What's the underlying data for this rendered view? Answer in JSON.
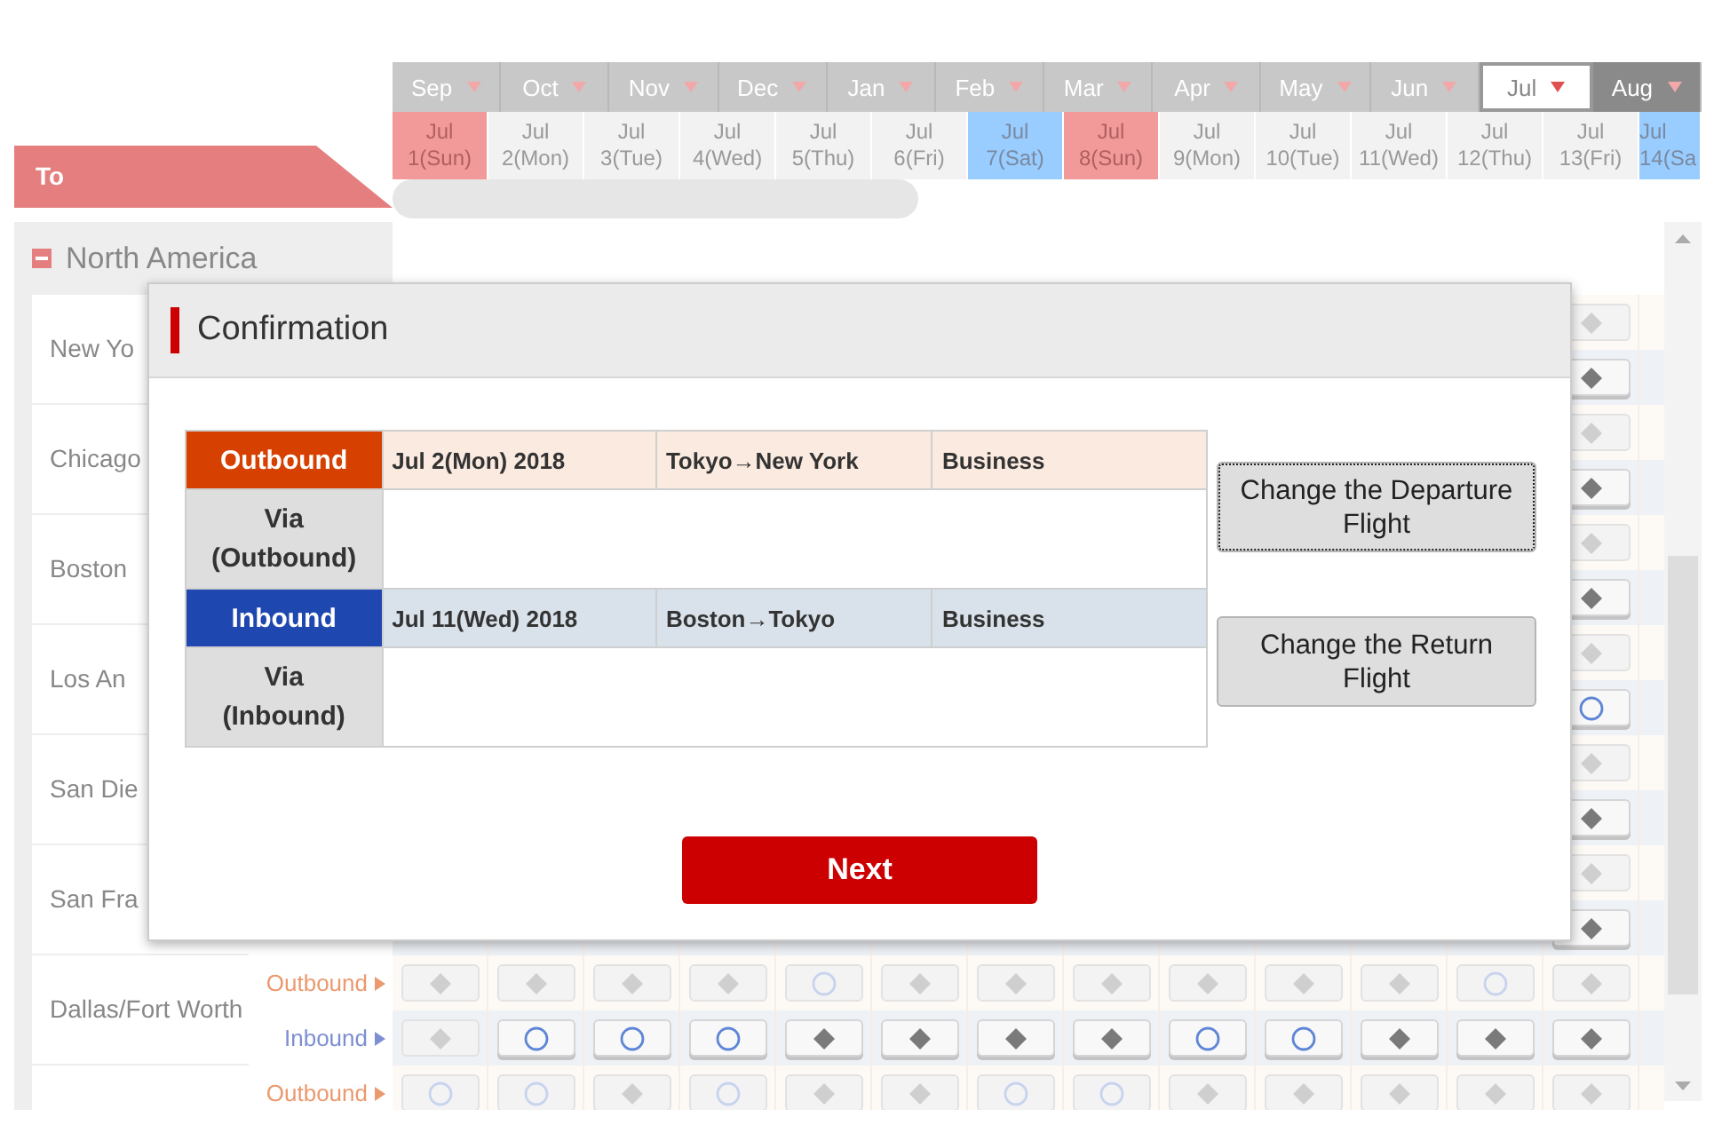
{
  "to_label": "To",
  "months": [
    {
      "label": "Sep",
      "selected": false,
      "highlighted": false
    },
    {
      "label": "Oct",
      "selected": false,
      "highlighted": false
    },
    {
      "label": "Nov",
      "selected": false,
      "highlighted": false
    },
    {
      "label": "Dec",
      "selected": false,
      "highlighted": false
    },
    {
      "label": "Jan",
      "selected": false,
      "highlighted": false
    },
    {
      "label": "Feb",
      "selected": false,
      "highlighted": false
    },
    {
      "label": "Mar",
      "selected": false,
      "highlighted": false
    },
    {
      "label": "Apr",
      "selected": false,
      "highlighted": false
    },
    {
      "label": "May",
      "selected": false,
      "highlighted": false
    },
    {
      "label": "Jun",
      "selected": false,
      "highlighted": false
    },
    {
      "label": "Jul",
      "selected": true,
      "highlighted": false
    },
    {
      "label": "Aug",
      "selected": false,
      "highlighted": true
    }
  ],
  "days": [
    {
      "month": "Jul",
      "day": "1(Sun)",
      "kind": "sunday"
    },
    {
      "month": "Jul",
      "day": "2(Mon)",
      "kind": "weekday"
    },
    {
      "month": "Jul",
      "day": "3(Tue)",
      "kind": "weekday"
    },
    {
      "month": "Jul",
      "day": "4(Wed)",
      "kind": "weekday"
    },
    {
      "month": "Jul",
      "day": "5(Thu)",
      "kind": "weekday"
    },
    {
      "month": "Jul",
      "day": "6(Fri)",
      "kind": "weekday"
    },
    {
      "month": "Jul",
      "day": "7(Sat)",
      "kind": "saturday"
    },
    {
      "month": "Jul",
      "day": "8(Sun)",
      "kind": "sunday"
    },
    {
      "month": "Jul",
      "day": "9(Mon)",
      "kind": "weekday"
    },
    {
      "month": "Jul",
      "day": "10(Tue)",
      "kind": "weekday"
    },
    {
      "month": "Jul",
      "day": "11(Wed)",
      "kind": "weekday"
    },
    {
      "month": "Jul",
      "day": "12(Thu)",
      "kind": "weekday"
    },
    {
      "month": "Jul",
      "day": "13(Fri)",
      "kind": "weekday"
    },
    {
      "month": "Jul",
      "day": "14(Sa",
      "kind": "saturday"
    }
  ],
  "region": {
    "name": "North America",
    "expanded": true
  },
  "cities": [
    {
      "name": "New Yo",
      "rows": [
        {
          "kind": "outbound",
          "cells": [
            null,
            null,
            null,
            null,
            null,
            null,
            null,
            null,
            null,
            null,
            null,
            null,
            {
              "kind": "diamond",
              "enabled": false
            }
          ]
        },
        {
          "kind": "inbound",
          "cells": [
            null,
            null,
            null,
            null,
            null,
            null,
            null,
            null,
            null,
            null,
            null,
            null,
            {
              "kind": "diamond",
              "enabled": true
            }
          ]
        }
      ]
    },
    {
      "name": "Chicago",
      "rows": [
        {
          "kind": "outbound",
          "cells": [
            null,
            null,
            null,
            null,
            null,
            null,
            null,
            null,
            null,
            null,
            null,
            null,
            {
              "kind": "diamond",
              "enabled": false
            }
          ]
        },
        {
          "kind": "inbound",
          "cells": [
            null,
            null,
            null,
            null,
            null,
            null,
            null,
            null,
            null,
            null,
            null,
            null,
            {
              "kind": "diamond",
              "enabled": true
            }
          ]
        }
      ]
    },
    {
      "name": "Boston",
      "rows": [
        {
          "kind": "outbound",
          "cells": [
            null,
            null,
            null,
            null,
            null,
            null,
            null,
            null,
            null,
            null,
            null,
            null,
            {
              "kind": "diamond",
              "enabled": false
            }
          ]
        },
        {
          "kind": "inbound",
          "cells": [
            null,
            null,
            null,
            null,
            null,
            null,
            null,
            null,
            null,
            null,
            null,
            null,
            {
              "kind": "diamond",
              "enabled": true
            }
          ]
        }
      ]
    },
    {
      "name": "Los An",
      "rows": [
        {
          "kind": "outbound",
          "cells": [
            null,
            null,
            null,
            null,
            null,
            null,
            null,
            null,
            null,
            null,
            null,
            null,
            {
              "kind": "diamond",
              "enabled": false
            }
          ]
        },
        {
          "kind": "inbound",
          "cells": [
            null,
            null,
            null,
            null,
            null,
            null,
            null,
            null,
            null,
            null,
            null,
            null,
            {
              "kind": "circle",
              "enabled": true
            }
          ]
        }
      ]
    },
    {
      "name": "San Die",
      "rows": [
        {
          "kind": "outbound",
          "cells": [
            null,
            null,
            null,
            null,
            null,
            null,
            null,
            null,
            null,
            null,
            null,
            null,
            {
              "kind": "diamond",
              "enabled": false
            }
          ]
        },
        {
          "kind": "inbound",
          "cells": [
            null,
            null,
            null,
            null,
            null,
            null,
            null,
            null,
            null,
            null,
            null,
            null,
            {
              "kind": "diamond",
              "enabled": true
            }
          ]
        }
      ]
    },
    {
      "name": "San Fra",
      "rows": [
        {
          "kind": "outbound",
          "cells": [
            null,
            null,
            null,
            null,
            null,
            null,
            null,
            null,
            null,
            null,
            null,
            null,
            {
              "kind": "diamond",
              "enabled": false
            }
          ]
        },
        {
          "kind": "inbound",
          "cells": [
            null,
            null,
            null,
            null,
            null,
            null,
            null,
            null,
            null,
            null,
            null,
            null,
            {
              "kind": "diamond",
              "enabled": true
            }
          ]
        }
      ]
    },
    {
      "name": "Dallas/Fort Worth",
      "rows": [
        {
          "kind": "outbound",
          "label": "Outbound",
          "cells": [
            {
              "kind": "diamond",
              "enabled": false
            },
            {
              "kind": "diamond",
              "enabled": false
            },
            {
              "kind": "diamond",
              "enabled": false
            },
            {
              "kind": "diamond",
              "enabled": false
            },
            {
              "kind": "circle",
              "enabled": false
            },
            {
              "kind": "diamond",
              "enabled": false
            },
            {
              "kind": "diamond",
              "enabled": false
            },
            {
              "kind": "diamond",
              "enabled": false
            },
            {
              "kind": "diamond",
              "enabled": false
            },
            {
              "kind": "diamond",
              "enabled": false
            },
            {
              "kind": "diamond",
              "enabled": false
            },
            {
              "kind": "circle",
              "enabled": false
            },
            {
              "kind": "diamond",
              "enabled": false
            }
          ]
        },
        {
          "kind": "inbound",
          "label": "Inbound",
          "cells": [
            {
              "kind": "diamond",
              "enabled": false
            },
            {
              "kind": "circle",
              "enabled": true
            },
            {
              "kind": "circle",
              "enabled": true
            },
            {
              "kind": "circle",
              "enabled": true
            },
            {
              "kind": "diamond",
              "enabled": true
            },
            {
              "kind": "diamond",
              "enabled": true
            },
            {
              "kind": "diamond",
              "enabled": true
            },
            {
              "kind": "diamond",
              "enabled": true
            },
            {
              "kind": "circle",
              "enabled": true
            },
            {
              "kind": "circle",
              "enabled": true
            },
            {
              "kind": "diamond",
              "enabled": true
            },
            {
              "kind": "diamond",
              "enabled": true
            },
            {
              "kind": "diamond",
              "enabled": true
            }
          ]
        }
      ]
    },
    {
      "rows": [
        {
          "kind": "outbound",
          "label": "Outbound",
          "cells": [
            {
              "kind": "circle",
              "enabled": false
            },
            {
              "kind": "circle",
              "enabled": false
            },
            {
              "kind": "diamond",
              "enabled": false
            },
            {
              "kind": "circle",
              "enabled": false
            },
            {
              "kind": "diamond",
              "enabled": false
            },
            {
              "kind": "diamond",
              "enabled": false
            },
            {
              "kind": "circle",
              "enabled": false
            },
            {
              "kind": "circle",
              "enabled": false
            },
            {
              "kind": "diamond",
              "enabled": false
            },
            {
              "kind": "diamond",
              "enabled": false
            },
            {
              "kind": "diamond",
              "enabled": false
            },
            {
              "kind": "diamond",
              "enabled": false
            },
            {
              "kind": "diamond",
              "enabled": false
            }
          ]
        }
      ]
    }
  ],
  "dialog": {
    "title": "Confirmation",
    "legs": [
      {
        "kind": "outbound",
        "label": "Outbound",
        "date": "Jul 2(Mon) 2018",
        "route": "Tokyo→New York",
        "class": "Business",
        "via_label": "Via (Outbound)"
      },
      {
        "kind": "inbound",
        "label": "Inbound",
        "date": "Jul 11(Wed) 2018",
        "route": "Boston→Tokyo",
        "class": "Business",
        "via_label": "Via (Inbound)"
      }
    ],
    "buttons": [
      {
        "label": "Change the Departure Flight",
        "focused": true
      },
      {
        "label": "Change the Return Flight",
        "focused": false
      }
    ],
    "next": "Next"
  }
}
